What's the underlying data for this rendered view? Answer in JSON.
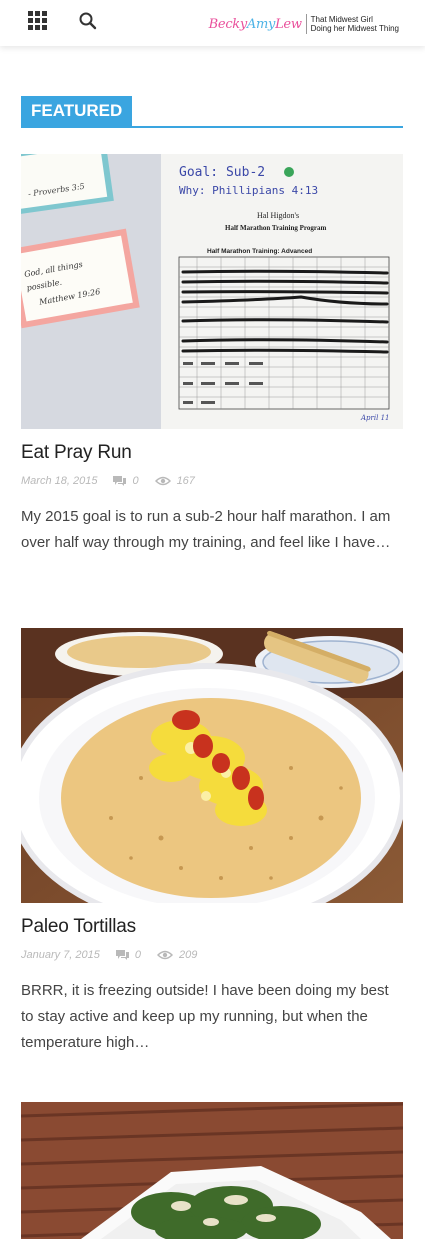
{
  "header": {
    "logo_part1": "Becky",
    "logo_part2": "Amy",
    "logo_part3": "Lew",
    "tagline_line1": "That Midwest Girl",
    "tagline_line2": "Doing her Midwest Thing"
  },
  "section": {
    "label": "FEATURED",
    "accent_color": "#3aa5e0"
  },
  "posts": [
    {
      "title": "Eat Pray Run",
      "date": "March 18, 2015",
      "comments": "0",
      "views": "167",
      "excerpt": "My 2015 goal is to run a sub-2 hour half marathon. I am over half way through my training, and feel like I have…",
      "image": {
        "goal_text": "Goal: Sub-2",
        "why_text": "Why: Phillipians 4:13",
        "program_title": "Hal Higdon's",
        "program_subtitle": "Half Marathon Training Program",
        "table_title": "Half Marathon Training: Advanced",
        "card1_text": "- Proverbs 3:5",
        "card2_line1": "God, all things",
        "card2_line2": "possible.",
        "card2_line3": "Matthew 19:26",
        "footer_text": "April 11"
      }
    },
    {
      "title": "Paleo Tortillas",
      "date": "January 7, 2015",
      "comments": "0",
      "views": "209",
      "excerpt": "BRRR, it is freezing outside! I have been doing my best to stay active and keep up my running, but when the temperature high…"
    },
    {
      "title": "",
      "date": "",
      "comments": "",
      "views": "",
      "excerpt": ""
    }
  ]
}
